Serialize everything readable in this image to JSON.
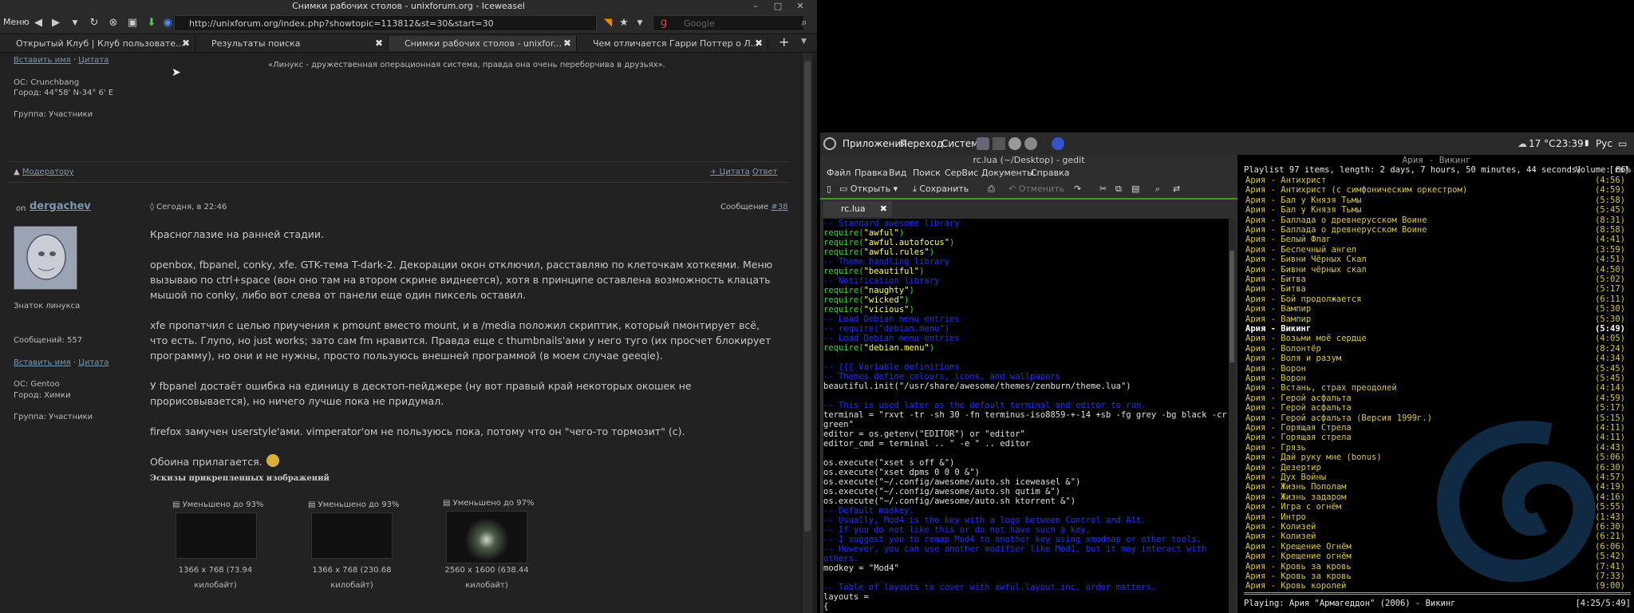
{
  "browser": {
    "title": "Снимки рабочих столов - unixforum.org - Iceweasel",
    "menu_label": "Меню",
    "url": "http://unixforum.org/index.php?showtopic=113812&st=30&start=30",
    "search_placeholder": "Google",
    "tabs": [
      {
        "label": "Открытый Клуб | Клуб пользовате..."
      },
      {
        "label": "Результаты поиска"
      },
      {
        "label": "Снимки рабочих столов - unixfor..."
      },
      {
        "label": "Чем отличается Гарри Поттер о Л..."
      }
    ],
    "prev_post": {
      "paste_name": "Вставить имя",
      "quote": "Цитата",
      "signature": "«Линукс - дружественная операционная система, правда она очень переборчива в друзьях».",
      "os": "ОС: Crunchbang",
      "city": "Город: 44°58' N-34° 6' E",
      "group": "Группа: Участники",
      "moderator": "Модератору",
      "plus_quote": "+ Цитата",
      "reply": "Ответ"
    },
    "post": {
      "author_prefix": "on",
      "author": "dergachev",
      "date": "◊ Сегодня, в 22:46",
      "msg_label": "Сообщение",
      "msg_num": "#38",
      "rank": "Знаток линукса",
      "messages": "Сообщений: 557",
      "paste_name": "Вставить имя",
      "quote": "Цитата",
      "os": "ОС: Gentoo",
      "city": "Город: Химки",
      "group": "Группа: Участники",
      "p1": "Красноглазие на ранней стадии.",
      "p2": "openbox, fbpanel, conky, xfe. GTK-тема T-dark-2. Декорации окон отключил, расставляю по клеточкам хоткеями. Меню вызываю по ctrl+space (вон оно там на втором скрине виднеется), хотя в принципе оставлена возможность клацать мышой по conky, либо вот слева от панели еще один пиксель оставил.",
      "p3": "xfe пропатчил с целью приучения к pmount вместо mount, и в /media положил скриптик, который пмонтирует всё, что есть. Глупо, но just works; зато сам fm нравится. Правда еще с thumbnails'ами у него туго (их просчет блокирует программу), но они и не нужны, просто пользуюсь внешней программой (в моем случае geeqie).",
      "p4": "У fbpanel достаёт ошибка на единицу в десктоп-пейджере (ну вот правый край некоторых окошек не прорисовывается), но ничего лучше пока не придумал.",
      "p5": "firefox замучен userstyle'ами. vimperator'ом не пользуюсь пока, потому что он \"чего-то тормозит\" (с).",
      "p6": "Обоина прилагается.",
      "attachments_title": "Эскизы прикрепленных изображений",
      "attachments": [
        {
          "label": "Уменьшено до 93%",
          "caption1": "1366 x 768 (73.94",
          "caption2": "килобайт)"
        },
        {
          "label": "Уменьшено до 93%",
          "caption1": "1366 x 768 (230.68",
          "caption2": "килобайт)"
        },
        {
          "label": "Уменьшено до 97%",
          "caption1": "2560 x 1600 (638.44",
          "caption2": "килобайт)"
        }
      ]
    }
  },
  "panel": {
    "menu_apps": "Приложения",
    "menu_go": "Переход",
    "menu_system": "Система",
    "weather": "17 °C",
    "clock": "23:39",
    "layout": "Рус"
  },
  "gedit": {
    "title": "rc.lua (~/Desktop) - gedit",
    "menu": [
      "Файл",
      "Правка",
      "Вид",
      "Поиск",
      "СерВис",
      "Документы",
      "Справка"
    ],
    "tool_open": "Открыть",
    "tool_save": "Сохранить",
    "tool_undo": "Отменить",
    "tab": "rc.lua",
    "code": [
      {
        "c": "com",
        "t": "-- Standard awesome library"
      },
      {
        "c": "req",
        "t": "require(\"awful\")",
        "s": true
      },
      {
        "c": "req",
        "t": "require(\"awful.autofocus\")",
        "s": true
      },
      {
        "c": "req",
        "t": "require(\"awful.rules\")",
        "s": true
      },
      {
        "c": "com",
        "t": "-- Theme handling library"
      },
      {
        "c": "req",
        "t": "require(\"beautiful\")",
        "s": true
      },
      {
        "c": "com",
        "t": "-- Notification library"
      },
      {
        "c": "req",
        "t": "require(\"naughty\")",
        "s": true
      },
      {
        "c": "req",
        "t": "require(\"wicked\")",
        "s": true
      },
      {
        "c": "req",
        "t": "require(\"vicious\")",
        "s": true
      },
      {
        "c": "com",
        "t": "-- Load Debian menu entries"
      },
      {
        "c": "com",
        "t": "-- require(\"debian.menu\")"
      },
      {
        "c": "com",
        "t": "-- Load Debian menu entries"
      },
      {
        "c": "req",
        "t": "require(\"debian.menu\")",
        "s": true
      },
      {
        "c": "txt",
        "t": ""
      },
      {
        "c": "com",
        "t": "-- {{{ Variable definitions"
      },
      {
        "c": "com",
        "t": "-- Themes define colours, icons, and wallpapers"
      },
      {
        "c": "txt",
        "t": "beautiful.init(\"/usr/share/awesome/themes/zenburn/theme.lua\")"
      },
      {
        "c": "txt",
        "t": ""
      },
      {
        "c": "com",
        "t": "-- This is used later as the default terminal and editor to run."
      },
      {
        "c": "txt",
        "t": "terminal = \"rxvt -tr -sh 30 -fn terminus-iso8859-+-14 +sb -fg grey -bg black -cr"
      },
      {
        "c": "txt",
        "t": "green\""
      },
      {
        "c": "txt",
        "t": "editor = os.getenv(\"EDITOR\") or \"editor\""
      },
      {
        "c": "txt",
        "t": "editor_cmd = terminal .. \" -e \" .. editor"
      },
      {
        "c": "txt",
        "t": ""
      },
      {
        "c": "txt",
        "t": "os.execute(\"xset s off &\")"
      },
      {
        "c": "txt",
        "t": "os.execute(\"xset dpms 0 0 0 &\")"
      },
      {
        "c": "txt",
        "t": "os.execute(\"~/.config/awesome/auto.sh iceweasel &\")"
      },
      {
        "c": "txt",
        "t": "os.execute(\"~/.config/awesome/auto.sh qutim &\")"
      },
      {
        "c": "txt",
        "t": "os.execute(\"~/.config/awesome/auto.sh ktorrent &\")"
      },
      {
        "c": "com",
        "t": "-- Default modkey."
      },
      {
        "c": "com",
        "t": "-- Usually, Mod4 is the key with a logo between Control and Alt."
      },
      {
        "c": "com",
        "t": "-- If you do not like this or do not have such a key,"
      },
      {
        "c": "com",
        "t": "-- I suggest you to remap Mod4 to another key using xmodmap or other tools."
      },
      {
        "c": "com",
        "t": "-- However, you can use another modifier like Mod1, but it may interact with"
      },
      {
        "c": "com",
        "t": "others."
      },
      {
        "c": "txt",
        "t": "modkey = \"Mod4\""
      },
      {
        "c": "txt",
        "t": ""
      },
      {
        "c": "com",
        "t": "-- Table of layouts to cover with awful.layout.inc, order matters."
      },
      {
        "c": "txt",
        "t": "layouts ="
      },
      {
        "c": "txt",
        "t": "{"
      }
    ]
  },
  "terminal": {
    "title": "Ария - Викинг",
    "corner": "[rs]",
    "status": "Playlist 97 items, length: 2 days, 7 hours, 50 minutes, 44 seconds)",
    "volume": "Volume: 86%",
    "current_index": 14,
    "songs": [
      {
        "t": "Ария - Антихрист",
        "d": "(4:56)"
      },
      {
        "t": "Ария - Антихрист (с симфоническим оркестром)",
        "d": "(4:59)"
      },
      {
        "t": "Ария - Бал у Князя Тьмы",
        "d": "(5:58)"
      },
      {
        "t": "Ария - Бал у Князя Тьмы",
        "d": "(5:45)"
      },
      {
        "t": "Ария - Баллада о древнерусском Воине",
        "d": "(8:31)"
      },
      {
        "t": "Ария - Баллада о древнерусском Воине",
        "d": "(8:58)"
      },
      {
        "t": "Ария - Белый Флаг",
        "d": "(4:41)"
      },
      {
        "t": "Ария - Беспечный ангел",
        "d": "(3:59)"
      },
      {
        "t": "Ария - Бивни Чёрных Скал",
        "d": "(4:51)"
      },
      {
        "t": "Ария - Бивни чёрных скал",
        "d": "(4:50)"
      },
      {
        "t": "Ария - Битва",
        "d": "(5:02)"
      },
      {
        "t": "Ария - Битва",
        "d": "(5:17)"
      },
      {
        "t": "Ария - Бой продолжается",
        "d": "(6:11)"
      },
      {
        "t": "Ария - Вампир",
        "d": "(5:30)"
      },
      {
        "t": "Ария - Вампир",
        "d": "(5:30)"
      },
      {
        "t": "Ария - Викинг",
        "d": "(5:49)"
      },
      {
        "t": "Ария - Возьми моё сердце",
        "d": "(4:05)"
      },
      {
        "t": "Ария - Волонтёр",
        "d": "(8:24)"
      },
      {
        "t": "Ария - Воля и разум",
        "d": "(4:34)"
      },
      {
        "t": "Ария - Ворон",
        "d": "(5:45)"
      },
      {
        "t": "Ария - Ворон",
        "d": "(5:45)"
      },
      {
        "t": "Ария - Встань, страх преодолей",
        "d": "(4:14)"
      },
      {
        "t": "Ария - Герой асфальта",
        "d": "(4:59)"
      },
      {
        "t": "Ария - Герой асфальта",
        "d": "(5:17)"
      },
      {
        "t": "Ария - Герой асфальта (Версия 1999г.)",
        "d": "(5:15)"
      },
      {
        "t": "Ария - Горящая Стрела",
        "d": "(4:11)"
      },
      {
        "t": "Ария - Горящая стрела",
        "d": "(4:11)"
      },
      {
        "t": "Ария - Грязь",
        "d": "(4:43)"
      },
      {
        "t": "Ария - Дай руку мне (bonus)",
        "d": "(5:06)"
      },
      {
        "t": "Ария - Дезертир",
        "d": "(6:30)"
      },
      {
        "t": "Ария - Дух Войны",
        "d": "(4:57)"
      },
      {
        "t": "Ария - Жизнь Пополам",
        "d": "(4:19)"
      },
      {
        "t": "Ария - Жизнь задаром",
        "d": "(4:16)"
      },
      {
        "t": "Ария - Игра с огнём",
        "d": "(5:55)"
      },
      {
        "t": "Ария - Интро",
        "d": "(1:43)"
      },
      {
        "t": "Ария - Колизей",
        "d": "(6:30)"
      },
      {
        "t": "Ария - Колизей",
        "d": "(6:21)"
      },
      {
        "t": "Ария - Крещение Огнём",
        "d": "(6:06)"
      },
      {
        "t": "Ария - Крещение огнём",
        "d": "(5:42)"
      },
      {
        "t": "Ария - Кровь за кровь",
        "d": "(7:41)"
      },
      {
        "t": "Ария - Кровь за кровь",
        "d": "(7:33)"
      },
      {
        "t": "Ария - Кровь королей",
        "d": "(9:00)"
      }
    ],
    "now_playing": "Playing: Ария \"Армагеддон\" (2006) - Викинг",
    "now_time": "[4:25/5:49]"
  }
}
